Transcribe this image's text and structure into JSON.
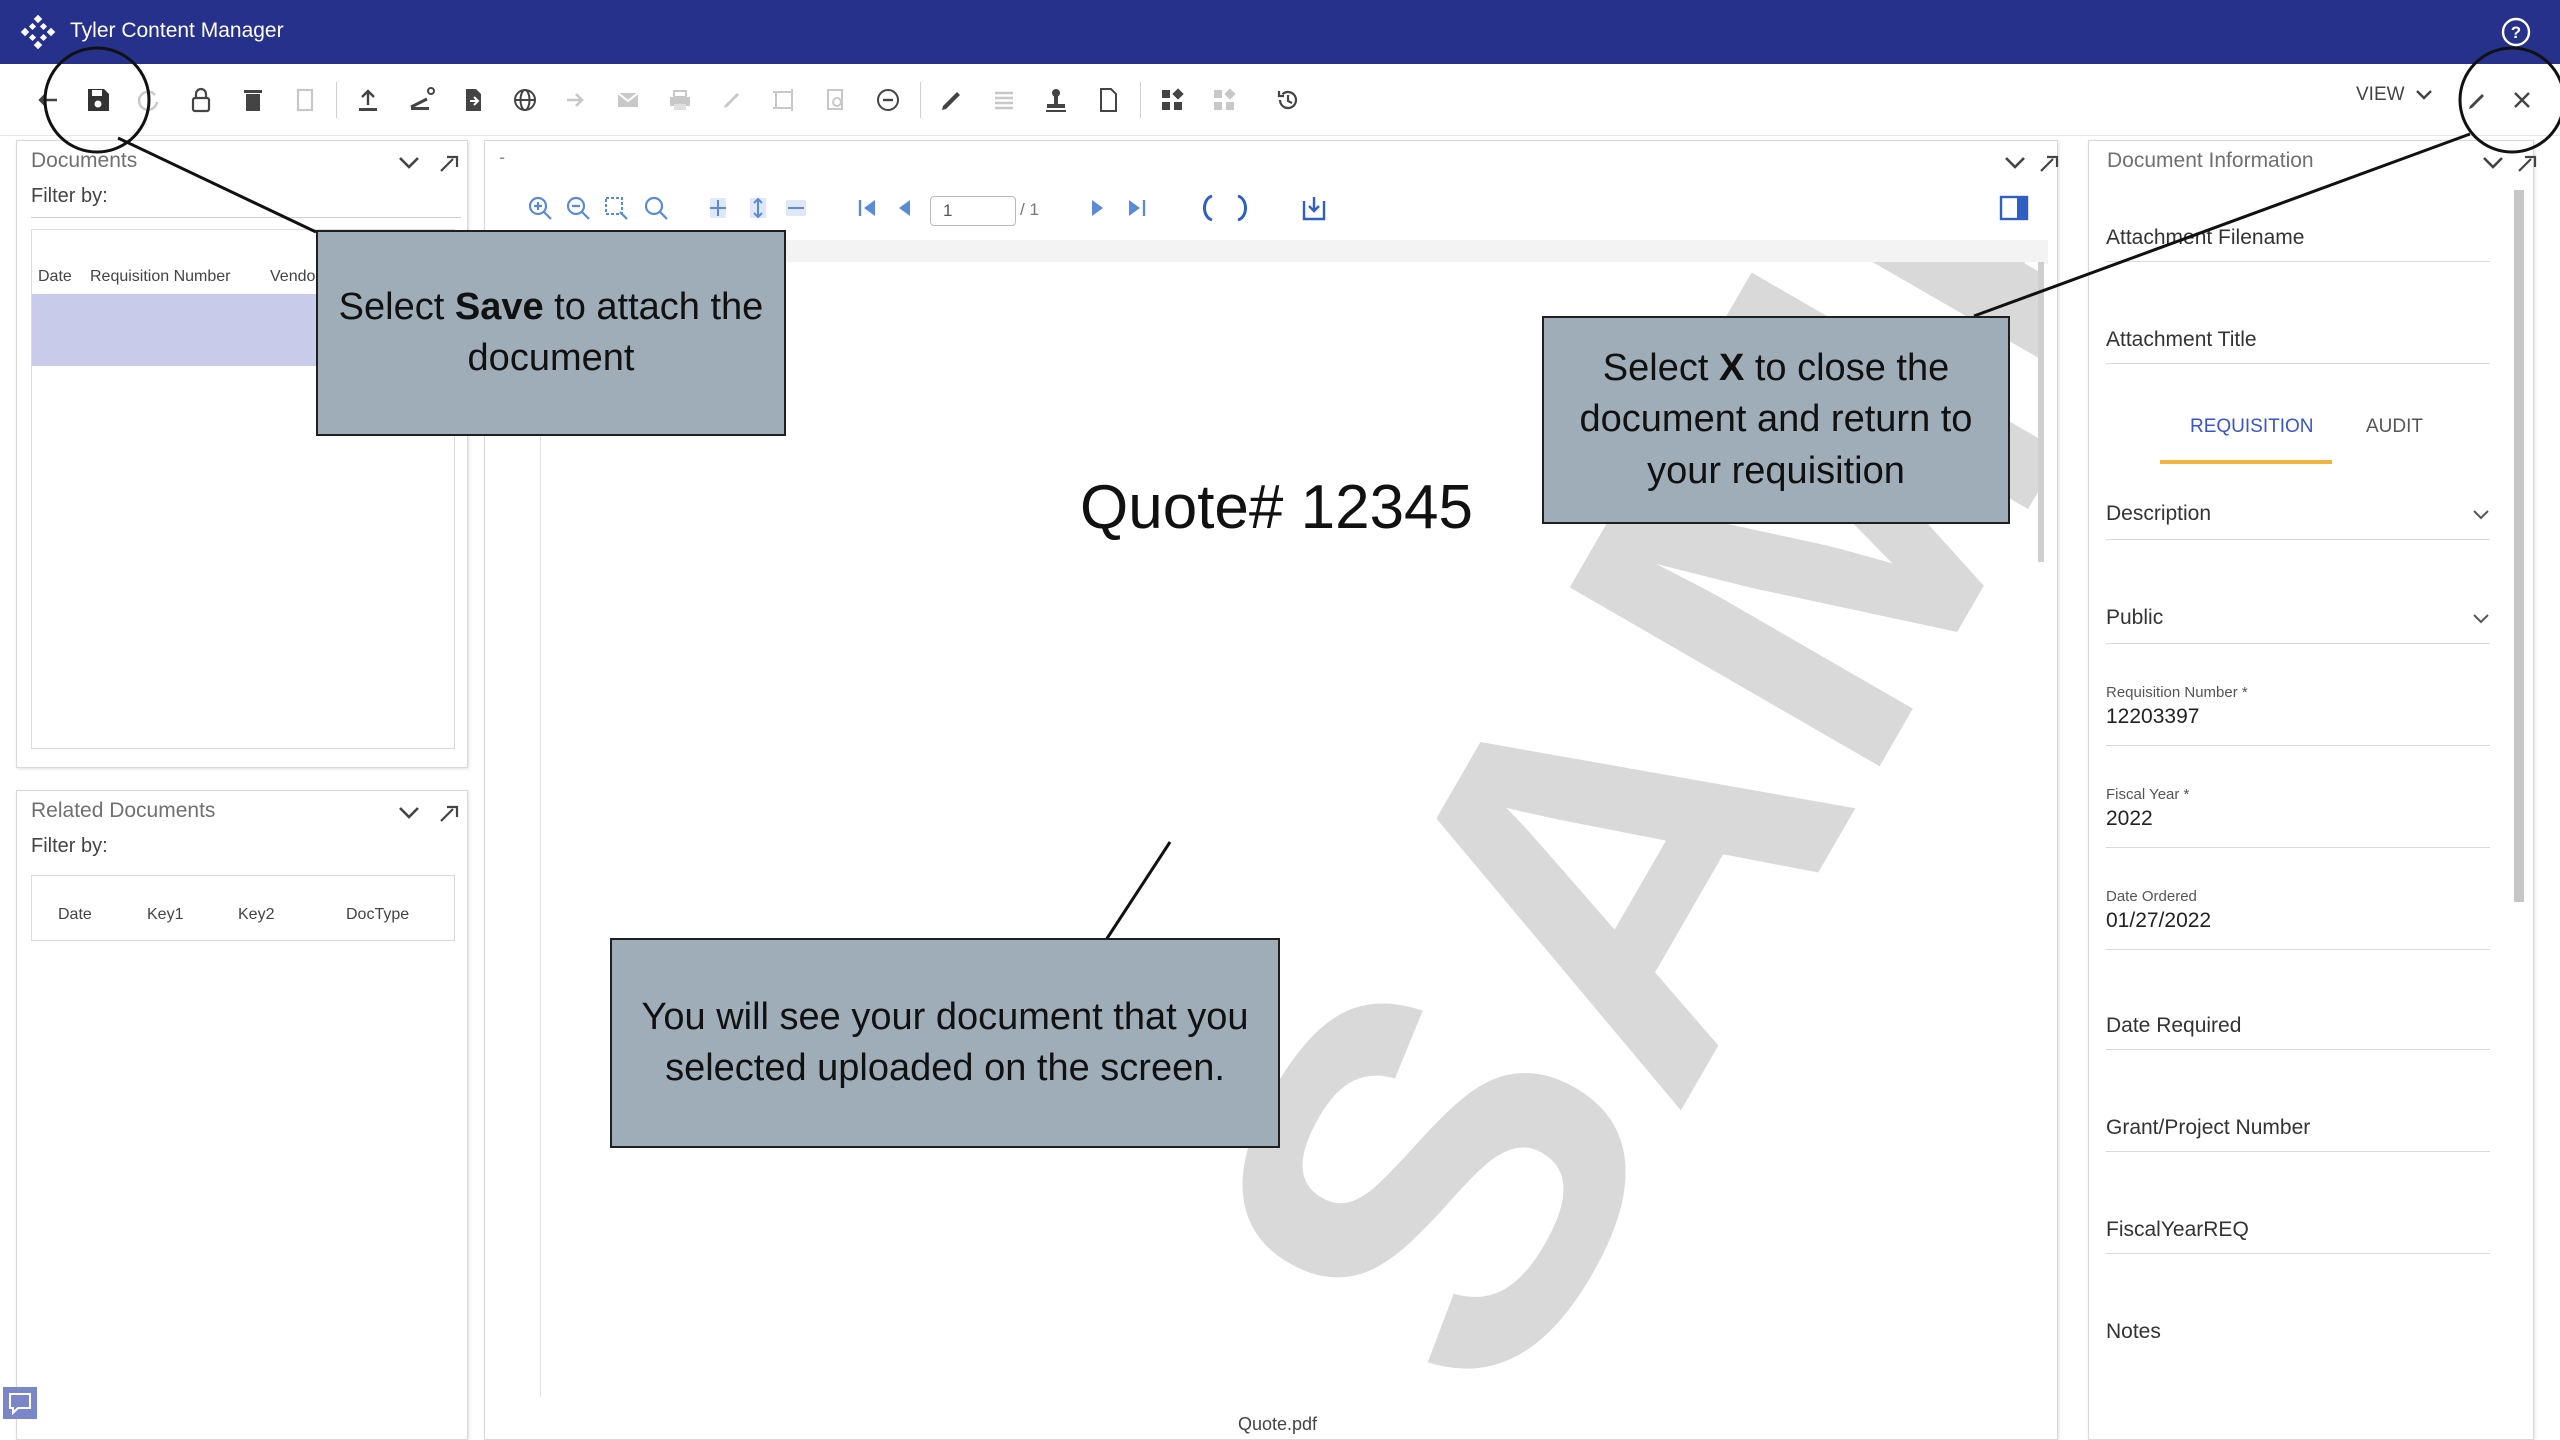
{
  "app": {
    "title": "Tyler Content Manager"
  },
  "toolbar": {
    "view_label": "VIEW"
  },
  "documents_panel": {
    "title": "Documents",
    "filter_label": "Filter by:",
    "columns": [
      "Date",
      "Requisition Number",
      "Vendor N"
    ]
  },
  "related_panel": {
    "title": "Related Documents",
    "filter_label": "Filter by:",
    "columns": [
      "Date",
      "Key1",
      "Key2",
      "DocType"
    ]
  },
  "viewer": {
    "page_value": "1",
    "page_total": "/ 1",
    "doc_heading": "Quote# 12345",
    "watermark": "SAMPLE",
    "filename": "Quote.pdf"
  },
  "info_panel": {
    "title": "Document Information",
    "attachment_filename_label": "Attachment Filename",
    "attachment_title_label": "Attachment Title",
    "tabs": [
      {
        "label": "REQUISITION"
      },
      {
        "label": "AUDIT"
      }
    ],
    "description_label": "Description",
    "security_value": "Public",
    "requisition_number_label": "Requisition Number *",
    "requisition_number_value": "12203397",
    "fiscal_year_label": "Fiscal Year *",
    "fiscal_year_value": "2022",
    "date_ordered_label": "Date Ordered",
    "date_ordered_value": "01/27/2022",
    "date_required_label": "Date Required",
    "grant_project_label": "Grant/Project Number",
    "fiscal_year_req_label": "FiscalYearREQ",
    "notes_label": "Notes"
  },
  "callouts": {
    "save": {
      "pre": "Select ",
      "bold": "Save",
      "post": " to attach the document"
    },
    "close": {
      "pre": "Select ",
      "bold": "X",
      "post": " to close the document and return to your requisition"
    },
    "upload": {
      "text": "You will see your document that you selected uploaded on the screen."
    }
  },
  "colors": {
    "titlebar": "#26318c",
    "accent_tab": "#3a55c8",
    "tab_underline": "#f0b43c",
    "callout_bg": "#9eadb7",
    "selected_row": "#c9cbea"
  }
}
